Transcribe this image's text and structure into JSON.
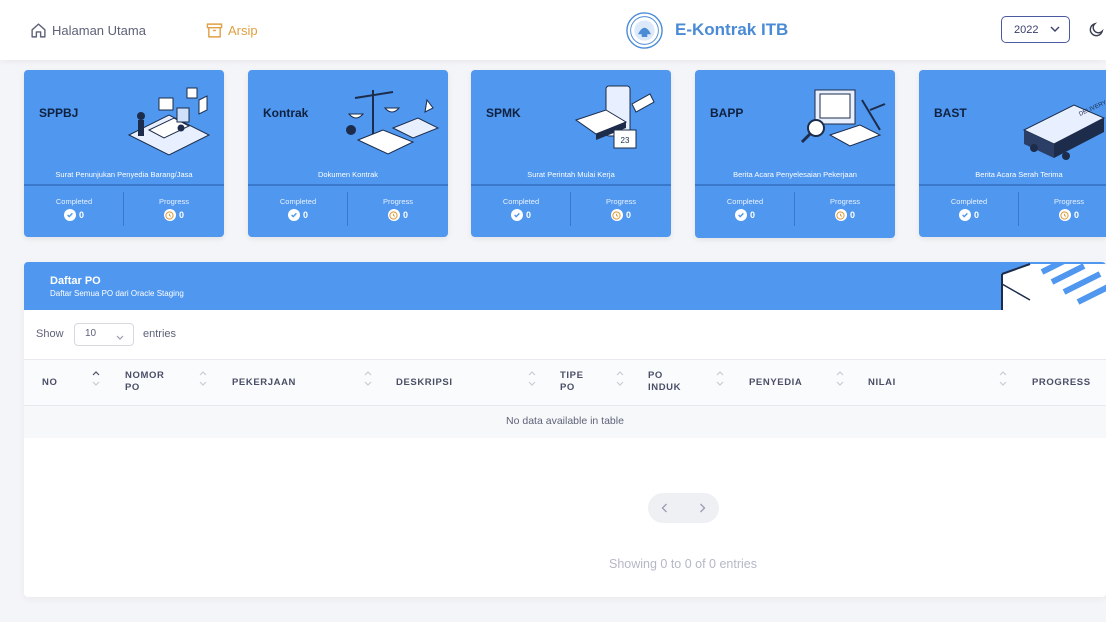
{
  "header": {
    "nav": [
      {
        "label": "Halaman Utama",
        "icon": "home-icon"
      },
      {
        "label": "Arsip",
        "icon": "archive-icon"
      }
    ],
    "brand": "E-Kontrak ITB",
    "year": "2022",
    "theme_icon": "moon-icon"
  },
  "cards": [
    {
      "title": "SPPBJ",
      "subtitle": "Surat Penunjukan Penyedia Barang/Jasa",
      "completed_label": "Completed",
      "completed": "0",
      "progress_label": "Progress",
      "progress": "0"
    },
    {
      "title": "Kontrak",
      "subtitle": "Dokumen Kontrak",
      "completed_label": "Completed",
      "completed": "0",
      "progress_label": "Progress",
      "progress": "0"
    },
    {
      "title": "SPMK",
      "subtitle": "Surat Perintah Mulai Kerja",
      "completed_label": "Completed",
      "completed": "0",
      "progress_label": "Progress",
      "progress": "0"
    },
    {
      "title": "BAPP",
      "subtitle": "Berita Acara Penyelesaian Pekerjaan",
      "completed_label": "Completed",
      "completed": "0",
      "progress_label": "Progress",
      "progress": "0"
    },
    {
      "title": "BAST",
      "subtitle": "Berita Acara Serah Terima",
      "completed_label": "Completed",
      "completed": "0",
      "progress_label": "Progress",
      "progress": "0"
    }
  ],
  "table": {
    "title": "Daftar PO",
    "subtitle": "Daftar Semua PO dari Oracle Staging",
    "show_label": "Show",
    "page_length": "10",
    "entries_label": "entries",
    "columns": [
      [
        "NO"
      ],
      [
        "NOMOR",
        "PO"
      ],
      [
        "PEKERJAAN"
      ],
      [
        "DESKRIPSI"
      ],
      [
        "TIPE",
        "PO"
      ],
      [
        "PO",
        "INDUK"
      ],
      [
        "PENYEDIA"
      ],
      [
        "NILAI"
      ],
      [
        "PROGRESS"
      ]
    ],
    "empty_message": "No data available in table",
    "info": "Showing 0 to 0 of 0 entries"
  },
  "colors": {
    "accent": "#4f97ef",
    "archive": "#e0a043",
    "brand": "#4a8bd6"
  }
}
